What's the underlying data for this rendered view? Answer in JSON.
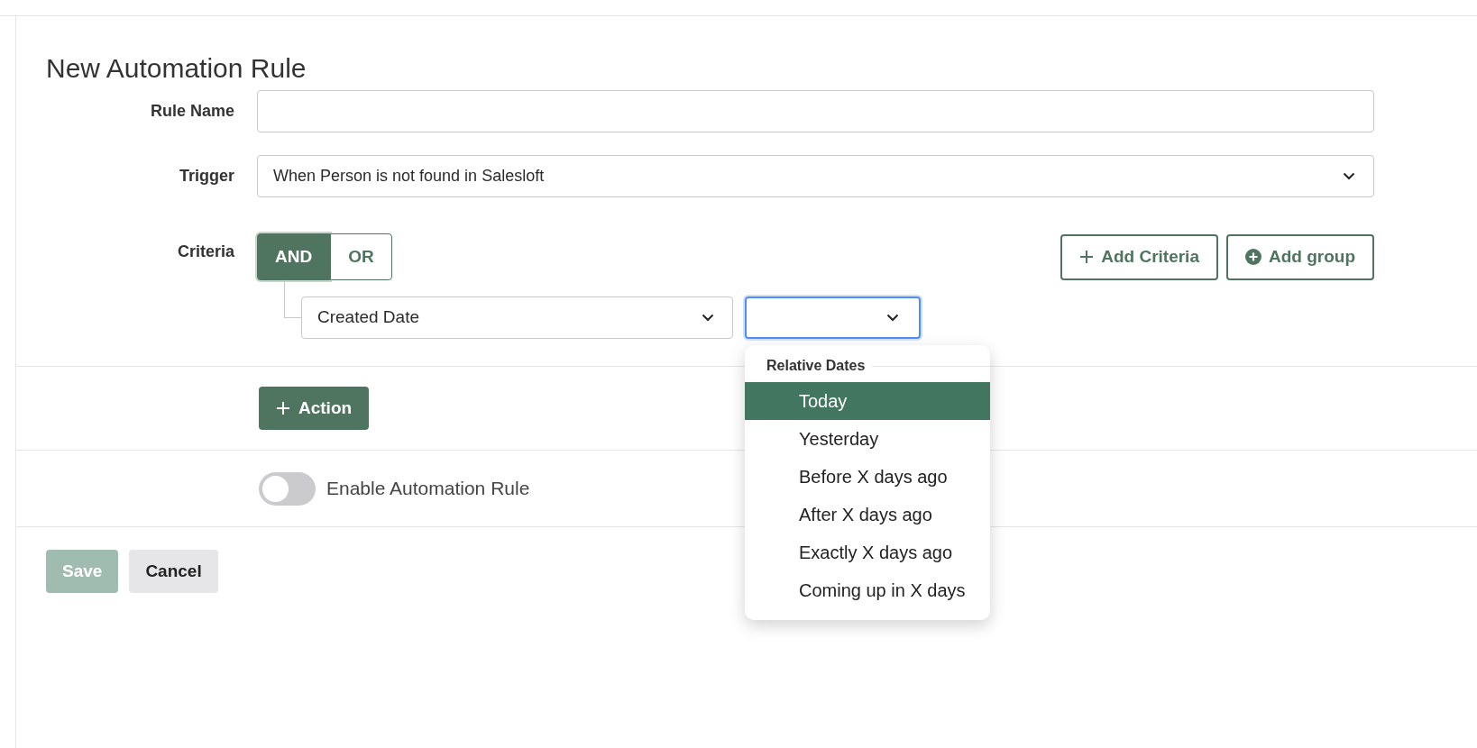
{
  "title": "New Automation Rule",
  "rule_name": {
    "label": "Rule Name"
  },
  "trigger": {
    "label": "Trigger",
    "value": "When Person is not found in Salesloft"
  },
  "criteria": {
    "label": "Criteria",
    "operators": [
      {
        "label": "AND",
        "selected": true
      },
      {
        "label": "OR",
        "selected": false
      }
    ],
    "buttons": [
      {
        "kind": "plus",
        "label": "Add Criteria"
      },
      {
        "kind": "circle",
        "label": "Add group"
      }
    ],
    "field": {
      "value": "Created Date"
    },
    "condition": {
      "focused": true,
      "dropdown": {
        "group": "Relative Dates",
        "options": [
          {
            "label": "Today",
            "selected": true
          },
          {
            "label": "Yesterday",
            "selected": false
          },
          {
            "label": "Before X days ago",
            "selected": false
          },
          {
            "label": "After X days ago",
            "selected": false
          },
          {
            "label": "Exactly X days ago",
            "selected": false
          },
          {
            "label": "Coming up in X days",
            "selected": false
          }
        ]
      }
    }
  },
  "action_button": {
    "label": "Action"
  },
  "enable": {
    "label": "Enable Automation Rule",
    "on": false
  },
  "buttons": [
    {
      "kind": "primary",
      "label": "Save",
      "disabled": true
    },
    {
      "kind": "secondary",
      "label": "Cancel",
      "disabled": false
    }
  ]
}
